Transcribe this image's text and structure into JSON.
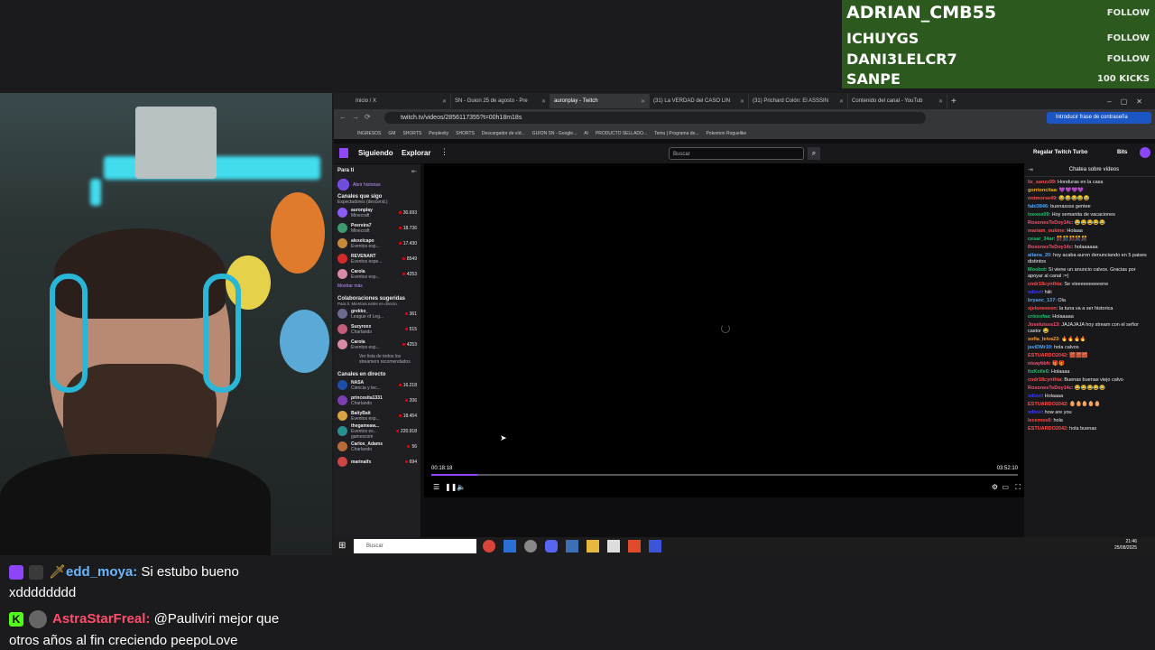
{
  "follow_panel": {
    "rows": [
      {
        "name": "ADRIAN_CMB55",
        "tag": "FOLLOW"
      },
      {
        "name": "ICHUYGS",
        "tag": "FOLLOW"
      },
      {
        "name": "DANI3LELCR7",
        "tag": "FOLLOW"
      },
      {
        "name": "SANPE",
        "tag": "100 KICKS"
      }
    ]
  },
  "stream_chat": {
    "messages": [
      {
        "user": "edd_moya",
        "text": "Si estubo bueno",
        "cont": "xdddddddd",
        "user_color": "#6ab7ff"
      },
      {
        "user": "AstraStarFreal",
        "text": "@Pauliviri mejor que",
        "cont": "otros años al fin creciendo peepoLove",
        "user_color": "#ff4d6d"
      }
    ]
  },
  "browser": {
    "tabs": [
      {
        "label": "Inicio / X",
        "active": false
      },
      {
        "label": "SN - Guion 25 de agosto - Pre",
        "active": false
      },
      {
        "label": "auronplay - Twitch",
        "active": true
      },
      {
        "label": "(31) La VERDAD del CASO LIN",
        "active": false
      },
      {
        "label": "(31) Prichard Colón: El ASSSIN",
        "active": false
      },
      {
        "label": "Contenido del canal - YouTub",
        "active": false
      }
    ],
    "url": "twitch.tv/videos/2856117355?t=00h18m18s",
    "password_prompt": "Introducir frase de contraseña",
    "bookmarks": [
      "INGRESOS",
      "GM",
      "SHORTS",
      "Perplexity",
      "SHORTS",
      "Descargador de víd...",
      "GUION SN - Google...",
      "AI",
      "PRODUCTO SELLADO...",
      "Temu | Programa de...",
      "Pokemon Roguelike"
    ]
  },
  "twitch": {
    "nav": {
      "following": "Siguiendo",
      "browse": "Explorar",
      "search_placeholder": "Buscar",
      "gift_turbo": "Regalar Twitch Turbo",
      "bits": "Bits"
    },
    "sidebar": {
      "for_you": "Para ti",
      "stories": "Abrir historias",
      "followed_header": "Canales que sigo",
      "followed_sub": "Espectadores (descend.)",
      "followed": [
        {
          "name": "auronplay",
          "game": "Minecraft",
          "count": "30.693",
          "color": "#8a5cf6"
        },
        {
          "name": "Peereira7",
          "game": "Minecraft",
          "count": "18.736",
          "color": "#3d9b6e"
        },
        {
          "name": "alexelcapo",
          "game": "Eventos esp...",
          "count": "17.430",
          "color": "#c48a3a"
        },
        {
          "name": "REVENANT",
          "game": "Eventos espe...",
          "count": "8549",
          "color": "#d12a2a"
        },
        {
          "name": "Carola",
          "game": "Eventos esp...",
          "count": "4253",
          "color": "#d88aa8"
        }
      ],
      "show_more": "Mostrar más",
      "collab_header": "Colaboraciones sugeridas",
      "collab_sub": "Para ti. Mientras estés en directo.",
      "collabs": [
        {
          "name": "grekko_",
          "game": "League of Leg...",
          "count": "361",
          "color": "#6b6b8f"
        },
        {
          "name": "Suzyroxx",
          "game": "Charlando",
          "count": "515",
          "color": "#c45c7a"
        },
        {
          "name": "Carola",
          "game": "Eventos esp...",
          "count": "4253",
          "color": "#d88aa8"
        }
      ],
      "collab_list": "Ver lista de todos los streamers recomendados",
      "live_header": "Canales en directo",
      "live": [
        {
          "name": "NASA",
          "game": "Ciencia y tec...",
          "count": "16.218",
          "color": "#1d4fa8"
        },
        {
          "name": "princesita1331",
          "game": "Charlando",
          "count": "206",
          "color": "#7b3fb0"
        },
        {
          "name": "BaityBait",
          "game": "Eventos esp...",
          "count": "18.454",
          "color": "#d9a441"
        },
        {
          "name": "thegameaw...",
          "game": "Eventos es... gamescom",
          "count": "220.918",
          "color": "#2a8f8f"
        },
        {
          "name": "Carlos_Adams",
          "game": "Charlando",
          "count": "56",
          "color": "#b86a3a"
        },
        {
          "name": "marinaifx",
          "game": "",
          "count": "694",
          "color": "#c44"
        }
      ]
    },
    "player": {
      "current_time": "00:18:18",
      "duration": "03:52:10",
      "progress": 0.079
    },
    "chat": {
      "title": "Chatea sobre vídeos",
      "messages": [
        {
          "user": "liz_sanzz99",
          "text": "Honduras en la casa",
          "color": "#ff4d4d"
        },
        {
          "user": "gorrioncitaa",
          "text": "💜💜💜💜",
          "color": "#ffb300"
        },
        {
          "user": "notmorse49",
          "text": "😂😂😂😂😂",
          "color": "#ff4d4d"
        },
        {
          "user": "fabi3846",
          "text": "buenassss gentee",
          "color": "#4da6ff"
        },
        {
          "user": "txexos09",
          "text": "Hoy semanita de vacaciones",
          "color": "#21c16b"
        },
        {
          "user": "RosonesTeDoy14c",
          "text": "😂😂😂😂😂",
          "color": "#ff4d6d"
        },
        {
          "user": "mariam_oukine",
          "text": "Holaaa",
          "color": "#ff4d4d"
        },
        {
          "user": "cesar_34ar",
          "text": "🎊🎊🎊🎊🎊",
          "color": "#21c16b"
        },
        {
          "user": "RosonesTeDoy14c",
          "text": "holaaaaaa",
          "color": "#ff4d6d"
        },
        {
          "user": "aitana_20",
          "text": "hoy acaba auron denunciando en 5 paises distintos",
          "color": "#4da6ff"
        },
        {
          "user": "Moobot",
          "text": "Si viene un anuncio calvos. Gracias por apoyar al canal :=)",
          "color": "#21c16b"
        },
        {
          "user": "cndr18cynthia",
          "text": "Se vieeeeeeeeeene",
          "color": "#ff4d4d"
        },
        {
          "user": "xdixvi",
          "text": "hiiii",
          "color": "#3d3dff"
        },
        {
          "user": "bryanc_137",
          "text": "Ola",
          "color": "#4da6ff"
        },
        {
          "user": "xjeloneeeon",
          "text": "la tuna va a ser historica",
          "color": "#ff4d4d"
        },
        {
          "user": "crixxofaa",
          "text": "Holaaaaa",
          "color": "#21c16b"
        },
        {
          "user": "Joseluisss13",
          "text": "JAJAJAJA hoy stream con el señor castor 😂",
          "color": "#ff4d6d"
        },
        {
          "user": "sofia_leiva23",
          "text": "🔥🔥🔥🔥",
          "color": "#ff9f2e"
        },
        {
          "user": "javiDMr10",
          "text": "hola calvos",
          "color": "#4da6ff"
        },
        {
          "user": "ESTUARDO2042",
          "text": "🧱🧱🧱",
          "color": "#ff4d4d"
        },
        {
          "user": "nisaybbh",
          "text": "🎁🎁",
          "color": "#ff4d6d"
        },
        {
          "user": "ItsKolle6",
          "text": "Holaaaa",
          "color": "#21c16b"
        },
        {
          "user": "cndr18cynthia",
          "text": "Buenas buenas viejo calvo",
          "color": "#ff4d4d"
        },
        {
          "user": "RosonesTeDoy14c",
          "text": "😂😂😂😂😂",
          "color": "#ff4d6d"
        },
        {
          "user": "xdixvi",
          "text": "Holaaaa",
          "color": "#3d3dff"
        },
        {
          "user": "ESTUARDO2042",
          "text": "🥚🥚🥚🥚🥚",
          "color": "#ff4d4d"
        },
        {
          "user": "xdixvi",
          "text": "how are you",
          "color": "#3d3dff"
        },
        {
          "user": "lecernes6",
          "text": "hola",
          "color": "#ff4d4d"
        },
        {
          "user": "ESTUARDO2042",
          "text": "hola buenas",
          "color": "#ff4d4d"
        }
      ]
    }
  },
  "taskbar": {
    "search_placeholder": "Buscar",
    "time": "21:46",
    "date": "25/08/2025"
  }
}
